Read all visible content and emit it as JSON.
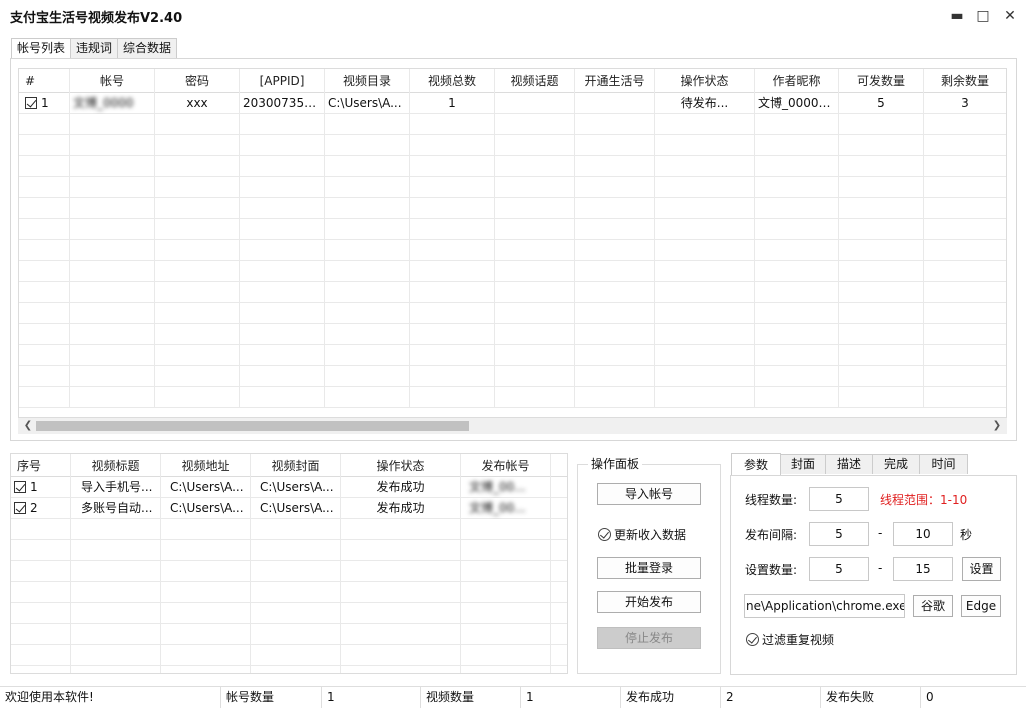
{
  "window": {
    "title": "支付宝生活号视频发布V2.40",
    "minimize": "▬",
    "maximize": "□",
    "close": "✕"
  },
  "top_tabs": [
    "帐号列表",
    "违规词",
    "综合数据"
  ],
  "accounts_table": {
    "columns": [
      "#",
      "帐号",
      "密码",
      "[APPID]",
      "视频目录",
      "视频总数",
      "视频话题",
      "开通生活号",
      "操作状态",
      "作者昵称",
      "可发数量",
      "剩余数量"
    ],
    "rows": [
      {
        "index": "1",
        "account": "文博_0000",
        "password": "xxx",
        "appid": "2030073550...",
        "video_dir": "C:\\Users\\A...",
        "video_total": "1",
        "topic": "",
        "opened": "",
        "status": "待发布...",
        "nickname": "文博_00000...",
        "can_send": "5",
        "remaining": "3"
      }
    ]
  },
  "videos_table": {
    "columns": [
      "序号",
      "视频标题",
      "视频地址",
      "视频封面",
      "操作状态",
      "发布帐号"
    ],
    "rows": [
      {
        "index": "1",
        "title": "导入手机号...",
        "address": "C:\\Users\\A...",
        "cover": "C:\\Users\\A...",
        "status": "发布成功",
        "account": "文博_00..."
      },
      {
        "index": "2",
        "title": "多账号自动...",
        "address": "C:\\Users\\A...",
        "cover": "C:\\Users\\A...",
        "status": "发布成功",
        "account": "文博_00..."
      }
    ]
  },
  "ops_panel": {
    "title": "操作面板",
    "import_btn": "导入帐号",
    "update_income": "更新收入数据",
    "batch_login": "批量登录",
    "start_publish": "开始发布",
    "stop_publish": "停止发布"
  },
  "settings": {
    "tabs": [
      "参数",
      "封面",
      "描述",
      "完成",
      "时间"
    ],
    "thread_label": "线程数量:",
    "thread_value": "5",
    "thread_range": "线程范围：1-10",
    "interval_label": "发布间隔:",
    "interval_min": "5",
    "interval_dash": "-",
    "interval_max": "10",
    "interval_unit": "秒",
    "count_label": "设置数量:",
    "count_min": "5",
    "count_dash": "-",
    "count_max": "15",
    "set_btn": "设置",
    "chrome_path": "ne\\Application\\chrome.exe",
    "google_btn": "谷歌",
    "edge_btn": "Edge",
    "filter_dup": "过滤重复视频"
  },
  "statusbar": {
    "welcome": "欢迎使用本软件!",
    "acc_label": "帐号数量",
    "acc_value": "1",
    "vid_label": "视频数量",
    "vid_value": "1",
    "ok_label": "发布成功",
    "ok_value": "2",
    "fail_label": "发布失败",
    "fail_value": "0"
  },
  "colors": {
    "range_red": "#e02020",
    "disabled_btn": "#cccccc"
  }
}
